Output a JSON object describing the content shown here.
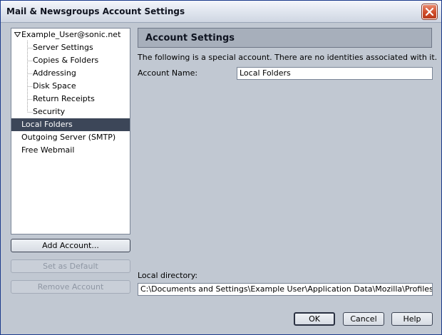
{
  "window": {
    "title": "Mail & Newsgroups Account Settings"
  },
  "tree": {
    "account": "Example_User@sonic.net",
    "children": [
      "Server Settings",
      "Copies & Folders",
      "Addressing",
      "Disk Space",
      "Return Receipts",
      "Security"
    ],
    "others": [
      "Local Folders",
      "Outgoing Server (SMTP)",
      "Free Webmail"
    ],
    "selected": "Local Folders"
  },
  "buttons": {
    "add_account": "Add Account...",
    "set_default": "Set as Default",
    "remove_account": "Remove Account",
    "ok": "OK",
    "cancel": "Cancel",
    "help": "Help"
  },
  "panel": {
    "header": "Account Settings",
    "description": "The following is a special account. There are no identities associated with it.",
    "account_name_label": "Account Name:",
    "account_name_value": "Local Folders",
    "local_directory_label": "Local directory:",
    "local_directory_value": "C:\\Documents and Settings\\Example User\\Application Data\\Mozilla\\Profiles\\default\\fjx"
  },
  "colors": {
    "window_bg": "#c1c8d2",
    "selection": "#3c4658",
    "header_bar": "#a7afbb"
  }
}
